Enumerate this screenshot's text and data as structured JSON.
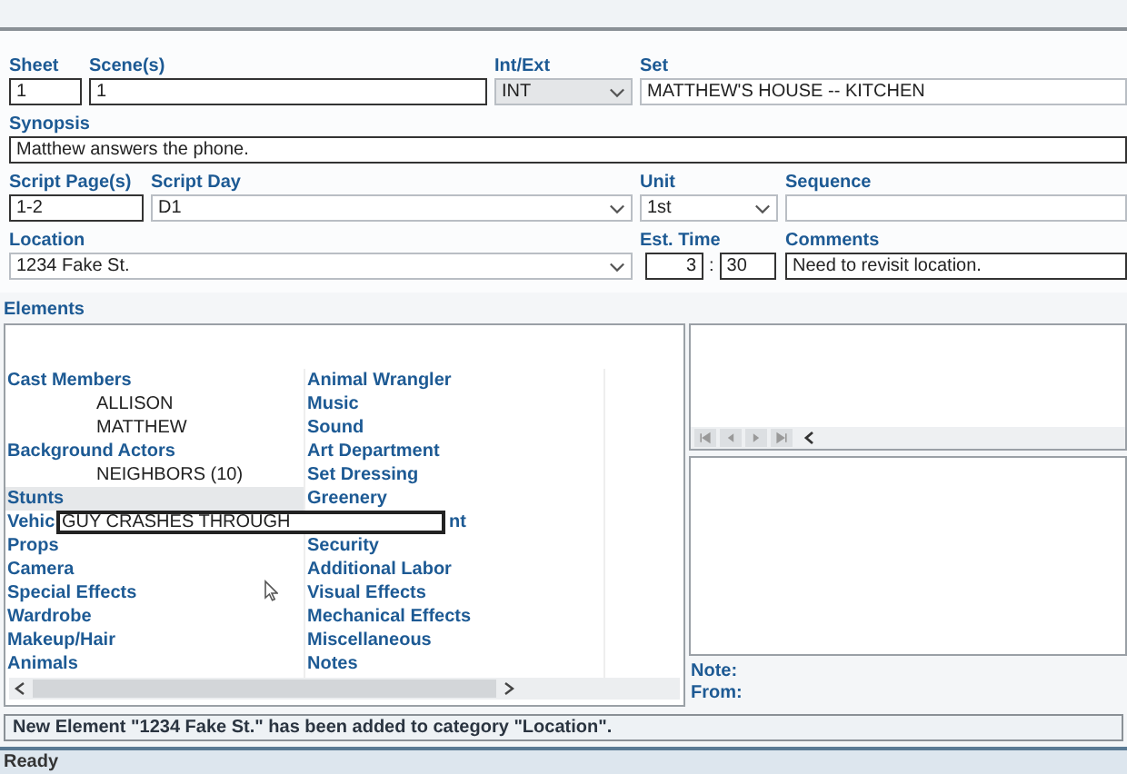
{
  "form": {
    "sheet": {
      "label": "Sheet",
      "value": "1"
    },
    "scenes": {
      "label": "Scene(s)",
      "value": "1"
    },
    "int_ext": {
      "label": "Int/Ext",
      "value": "INT",
      "disabled": true
    },
    "set": {
      "label": "Set",
      "value": "MATTHEW'S HOUSE -- KITCHEN"
    },
    "synopsis": {
      "label": "Synopsis",
      "value": "Matthew answers the phone."
    },
    "script_pages": {
      "label": "Script Page(s)",
      "value": "1-2"
    },
    "script_day": {
      "label": "Script Day",
      "value": "D1",
      "disabled": false
    },
    "unit": {
      "label": "Unit",
      "value": "1st",
      "disabled": false
    },
    "sequence": {
      "label": "Sequence"
    },
    "location": {
      "label": "Location",
      "value": "1234 Fake St.",
      "disabled": false
    },
    "est_time": {
      "label": "Est. Time",
      "hours": "3",
      "separator": ":",
      "minutes": "30"
    },
    "comments": {
      "label": "Comments",
      "value": "Need to revisit location."
    }
  },
  "elements": {
    "title": "Elements",
    "columns": [
      [
        {
          "name": "Cast Members",
          "selected": false,
          "children": [
            {
              "name": "ALLISON"
            },
            {
              "name": "MATTHEW"
            }
          ]
        },
        {
          "name": "Background Actors",
          "selected": false,
          "children": [
            {
              "name": "NEIGHBORS (10)"
            }
          ]
        },
        {
          "name": "Stunts",
          "selected": true
        },
        {
          "name": "Vehic",
          "selected": false
        },
        {
          "name": "Props",
          "selected": false
        },
        {
          "name": "Camera",
          "selected": false
        },
        {
          "name": "Special Effects",
          "selected": false
        },
        {
          "name": "Wardrobe",
          "selected": false
        },
        {
          "name": "Makeup/Hair",
          "selected": false
        },
        {
          "name": "Animals",
          "selected": false
        }
      ],
      [
        {
          "name": "Animal Wrangler",
          "selected": false
        },
        {
          "name": "Music",
          "selected": false
        },
        {
          "name": "Sound",
          "selected": false
        },
        {
          "name": "Art Department",
          "selected": false
        },
        {
          "name": "Set Dressing",
          "selected": false
        },
        {
          "name": "Greenery",
          "selected": false
        },
        {
          "name": "nt",
          "selected": false,
          "covered": true
        },
        {
          "name": "Security",
          "selected": false
        },
        {
          "name": "Additional Labor",
          "selected": false
        },
        {
          "name": "Visual Effects",
          "selected": false
        },
        {
          "name": "Mechanical Effects",
          "selected": false
        },
        {
          "name": "Miscellaneous",
          "selected": false
        },
        {
          "name": "Notes",
          "selected": false
        }
      ]
    ],
    "editor": {
      "value": "GUY CRASHES THROUGH"
    }
  },
  "detail": {
    "note_label": "Note:",
    "from_label": "From:"
  },
  "message": "New Element \"1234 Fake St.\" has been added to category \"Location\".",
  "status_bar": "Ready"
}
